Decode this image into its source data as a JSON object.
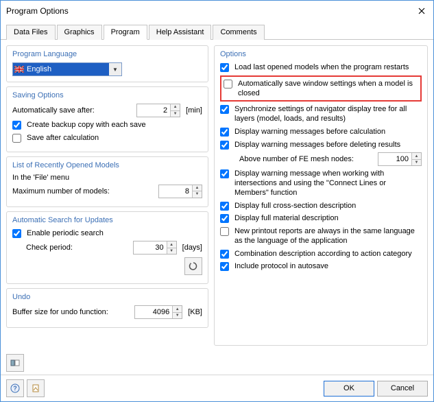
{
  "window": {
    "title": "Program Options"
  },
  "tabs": {
    "items": [
      {
        "label": "Data Files"
      },
      {
        "label": "Graphics"
      },
      {
        "label": "Program",
        "active": true
      },
      {
        "label": "Help Assistant"
      },
      {
        "label": "Comments"
      }
    ]
  },
  "lang_group": {
    "title": "Program Language",
    "selected": "English"
  },
  "saving": {
    "title": "Saving Options",
    "auto_label": "Automatically save after:",
    "auto_value": "2",
    "auto_unit": "[min]",
    "backup_label": "Create backup copy with each save",
    "backup_checked": true,
    "after_calc_label": "Save after calculation",
    "after_calc_checked": false
  },
  "recent": {
    "title": "List of Recently Opened Models",
    "file_menu_label": "In the 'File' menu",
    "max_label": "Maximum number of models:",
    "max_value": "8"
  },
  "updates": {
    "title": "Automatic Search for Updates",
    "enable_label": "Enable periodic search",
    "enable_checked": true,
    "period_label": "Check period:",
    "period_value": "30",
    "period_unit": "[days]"
  },
  "undo": {
    "title": "Undo",
    "buffer_label": "Buffer size for undo function:",
    "buffer_value": "4096",
    "buffer_unit": "[KB]"
  },
  "options": {
    "title": "Options",
    "load_last": {
      "label": "Load last opened models when the program restarts",
      "checked": true
    },
    "auto_save_win": {
      "label": "Automatically save window settings when a model is closed",
      "checked": false
    },
    "sync_tree": {
      "label": "Synchronize settings of navigator display tree for all layers (model, loads, and results)",
      "checked": true
    },
    "warn_calc": {
      "label": "Display warning messages before calculation",
      "checked": true
    },
    "warn_delete": {
      "label": "Display warning messages before deleting results",
      "checked": true
    },
    "above_nodes_label": "Above number of FE mesh nodes:",
    "above_nodes_value": "100",
    "warn_intersections": {
      "label": "Display warning message when working with intersections and using the \"Connect Lines or Members\" function",
      "checked": true
    },
    "full_cs": {
      "label": "Display full cross-section description",
      "checked": true
    },
    "full_mat": {
      "label": "Display full material description",
      "checked": true
    },
    "reports_lang": {
      "label": "New printout reports are always in the same language as the language of the application",
      "checked": false
    },
    "combo_desc": {
      "label": "Combination description according to action category",
      "checked": true
    },
    "include_protocol": {
      "label": "Include protocol in autosave",
      "checked": true
    }
  },
  "footer": {
    "ok": "OK",
    "cancel": "Cancel"
  }
}
